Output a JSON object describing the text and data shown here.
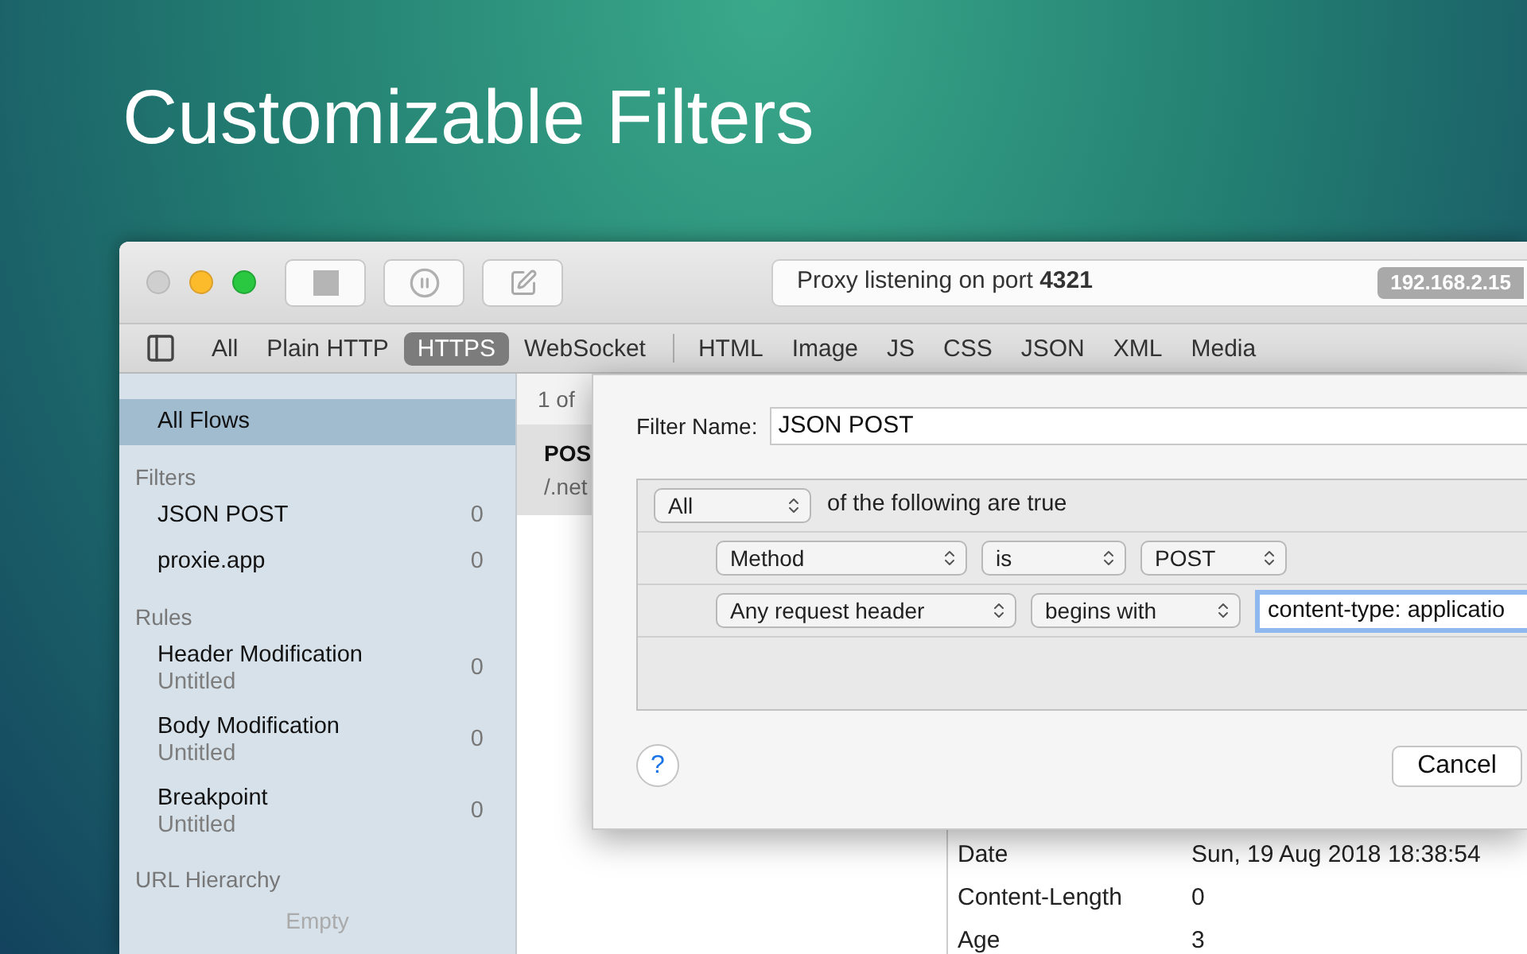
{
  "headline": "Customizable Filters",
  "toolbar": {
    "address_text": "Proxy listening on port **4321**",
    "ip_badge": "192.168.2.15"
  },
  "tab_groups": [
    [
      {
        "label": "All",
        "selected": false
      },
      {
        "label": "Plain HTTP",
        "selected": false
      },
      {
        "label": "HTTPS",
        "selected": true
      },
      {
        "label": "WebSocket",
        "selected": false
      }
    ],
    [
      {
        "label": "HTML",
        "selected": false
      },
      {
        "label": "Image",
        "selected": false
      },
      {
        "label": "JS",
        "selected": false
      },
      {
        "label": "CSS",
        "selected": false
      },
      {
        "label": "JSON",
        "selected": false
      },
      {
        "label": "XML",
        "selected": false
      },
      {
        "label": "Media",
        "selected": false
      }
    ]
  ],
  "sidebar": {
    "top_item": {
      "label": "All Flows",
      "selected": true
    },
    "sections": [
      {
        "title": "Filters",
        "items": [
          {
            "label": "JSON POST",
            "count": "0"
          },
          {
            "label": "proxie.app",
            "count": "0"
          }
        ]
      },
      {
        "title": "Rules",
        "items": [
          {
            "label": "Header Modification",
            "subtitle": "Untitled",
            "count": "0"
          },
          {
            "label": "Body Modification",
            "subtitle": "Untitled",
            "count": "0"
          },
          {
            "label": "Breakpoint",
            "subtitle": "Untitled",
            "count": "0"
          }
        ]
      },
      {
        "title": "URL Hierarchy",
        "empty_text": "Empty"
      }
    ]
  },
  "flow_list": {
    "counter": "1 of",
    "rows": [
      {
        "method": "POS",
        "path": "/.net",
        "selected": true
      }
    ]
  },
  "details": [
    {
      "name": "Date",
      "value": "Sun, 19 Aug 2018 18:38:54"
    },
    {
      "name": "Content-Length",
      "value": "0"
    },
    {
      "name": "Age",
      "value": "3"
    }
  ],
  "dialog": {
    "name_label": "Filter Name:",
    "name_value": "JSON POST",
    "match": "All",
    "match_text": "of the following are true",
    "conditions": [
      {
        "field": "Method",
        "operator": "is",
        "value": "POST",
        "kind": "select"
      },
      {
        "field": "Any request header",
        "operator": "begins with",
        "value": "content-type: applicatio",
        "kind": "text"
      }
    ],
    "help": "?",
    "cancel": "Cancel"
  }
}
